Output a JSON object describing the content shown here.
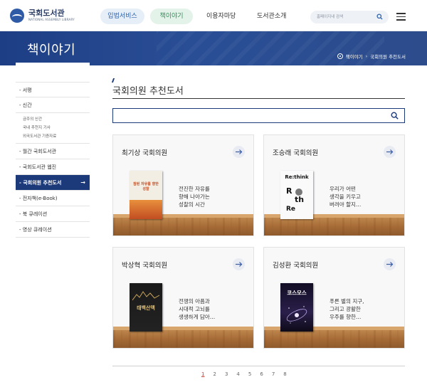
{
  "header": {
    "logo": {
      "title": "국회도서관",
      "subtitle": "NATIONAL ASSEMBLY LIBRARY"
    },
    "nav": [
      {
        "label": "입법서비스"
      },
      {
        "label": "책이야기"
      },
      {
        "label": "이용자마당"
      },
      {
        "label": "도서관소개"
      }
    ],
    "search_placeholder": "홈페이지내 검색"
  },
  "banner": {
    "title": "책이야기",
    "breadcrumb": [
      "책이야기",
      "국회의원 추천도서"
    ]
  },
  "sidebar": {
    "items": [
      {
        "label": "서평"
      },
      {
        "label": "신간"
      }
    ],
    "sub_items": [
      {
        "label": "금주의 신간"
      },
      {
        "label": "국내 추천지 기사"
      },
      {
        "label": "외국도서관 기증자료"
      }
    ],
    "items_after": [
      {
        "label": "월간 국회도서관"
      },
      {
        "label": "국회도서관 웹진"
      },
      {
        "label": "국회의원 추천도서",
        "active": true
      },
      {
        "label": "전자책(e-Book)"
      },
      {
        "label": "북 큐레이션"
      },
      {
        "label": "영상 큐레이션"
      }
    ]
  },
  "main": {
    "title": "국회의원 추천도서",
    "cards": [
      {
        "name": "최기상 국회의원",
        "description": "전진한 자유를\n향해 나아가는\n성찰의 시간",
        "book_text": "참된 자유를 향한 성찰"
      },
      {
        "name": "조승래 국회의원",
        "description": "우리가 어떤\n생각을 키우고\n버려야 할지…",
        "book_text": "Re:think"
      },
      {
        "name": "박상혁 국회의원",
        "description": "전쟁의 아픔과\n시대적 고뇌를\n생생하게 담아…",
        "book_text": "태백산맥"
      },
      {
        "name": "김성환 국회의원",
        "description": "푸른 별의 지구,\n그리고 광활한\n우주를 향한…",
        "book_text": "코스모스"
      }
    ]
  },
  "pagination": {
    "pages": [
      "1",
      "2",
      "3",
      "4",
      "5",
      "6",
      "7",
      "8"
    ],
    "current": "1"
  }
}
